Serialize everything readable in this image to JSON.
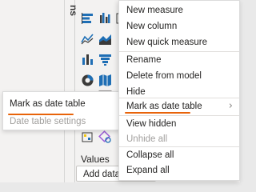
{
  "pane": {
    "title_fragment": "ns",
    "values_label": "Values",
    "add_data_text": "Add data f"
  },
  "context_menu": {
    "items": [
      {
        "label": "New measure",
        "disabled": false
      },
      {
        "label": "New column",
        "disabled": false
      },
      {
        "label": "New quick measure",
        "disabled": false
      },
      {
        "label": "Rename",
        "disabled": false
      },
      {
        "label": "Delete from model",
        "disabled": false
      },
      {
        "label": "Hide",
        "disabled": false
      },
      {
        "label": "Mark as date table",
        "disabled": false,
        "has_submenu": true
      },
      {
        "label": "View hidden",
        "disabled": false
      },
      {
        "label": "Unhide all",
        "disabled": true
      },
      {
        "label": "Collapse all",
        "disabled": false
      },
      {
        "label": "Expand all",
        "disabled": false
      }
    ],
    "submenu_arrow": "›"
  },
  "submenu": {
    "items": [
      {
        "label": "Mark as date table",
        "disabled": false
      },
      {
        "label": "Date table settings",
        "disabled": true
      }
    ]
  },
  "colors": {
    "accent_underline": "#e8630a",
    "icon_blue": "#1f6fb5",
    "icon_dark": "#3b3a39",
    "icon_yellow": "#f2c811"
  },
  "icons": [
    "stacked-bar-icon",
    "clustered-column-icon",
    "table-icon-partial",
    "line-chart-icon",
    "area-chart-icon",
    "column-chart-icon",
    "funnel-icon",
    "pie-chart-icon",
    "map-icon",
    "matrix-icon",
    "kpi-icon",
    "key-influencers-icon",
    "decomposition-tree-icon"
  ]
}
